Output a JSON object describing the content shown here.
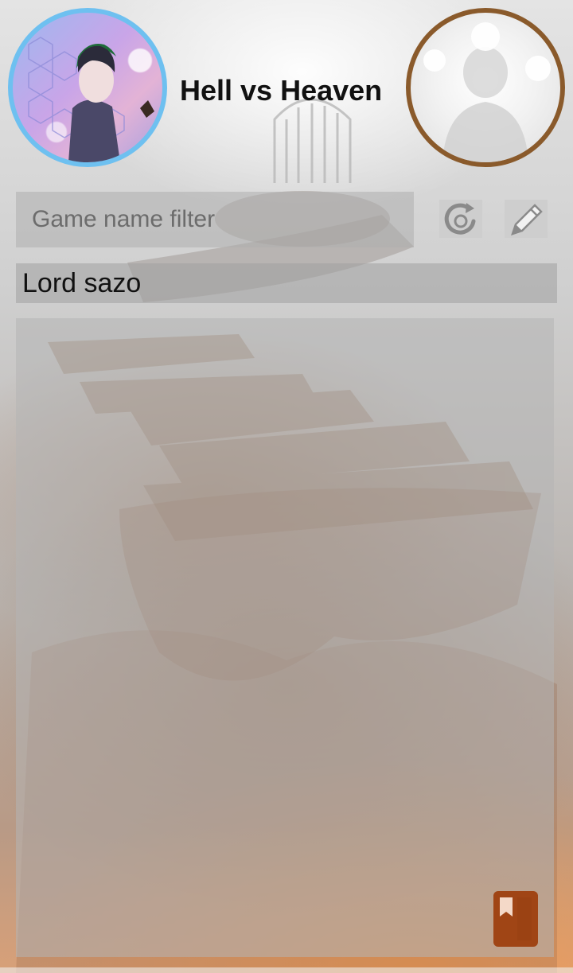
{
  "header": {
    "title": "Hell vs Heaven",
    "left_avatar": "player-avatar-image",
    "right_avatar": "angel-avatar-image"
  },
  "filter": {
    "placeholder": "Game name filter",
    "value": ""
  },
  "toolbar": {
    "refresh_icon": "refresh-icon",
    "edit_icon": "pencil-icon"
  },
  "players": [
    {
      "name": "Lord sazo"
    }
  ],
  "fab": {
    "icon": "bookmark-icon",
    "color": "#a04515"
  },
  "colors": {
    "left_ring": "#6ec0f0",
    "right_ring": "#8a5a2b"
  }
}
